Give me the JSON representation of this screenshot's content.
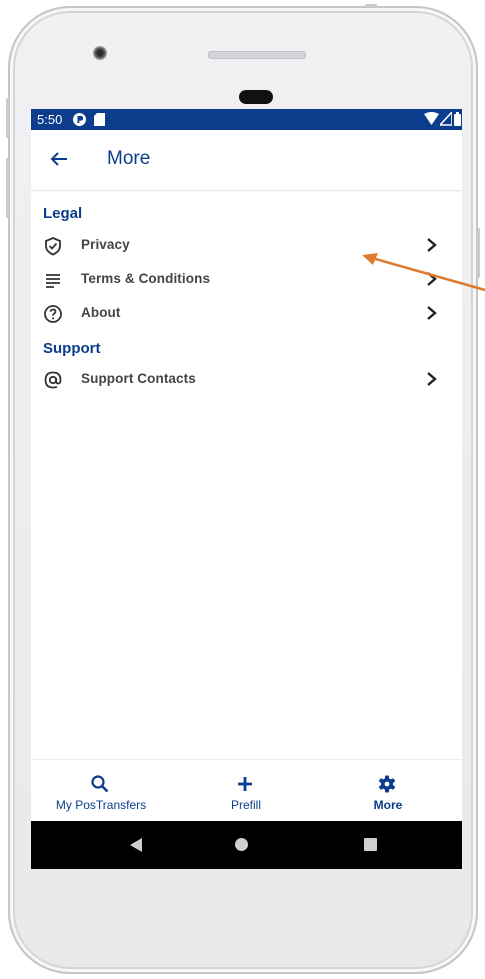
{
  "status_bar": {
    "time": "5:50"
  },
  "app_bar": {
    "title": "More"
  },
  "sections": [
    {
      "title": "Legal"
    },
    {
      "title": "Support"
    }
  ],
  "items": [
    {
      "label": "Privacy",
      "icon": "shield-check-icon"
    },
    {
      "label": "Terms & Conditions",
      "icon": "lines-icon"
    },
    {
      "label": "About",
      "icon": "question-circle-icon"
    },
    {
      "label": "Support Contacts",
      "icon": "at-sign-icon"
    }
  ],
  "bottom_nav": [
    {
      "label": "My PosTransfers",
      "icon": "search-icon"
    },
    {
      "label": "Prefill",
      "icon": "plus-icon"
    },
    {
      "label": "More",
      "icon": "gear-icon",
      "active": true
    }
  ],
  "colors": {
    "primary": "#0b3d8c",
    "annotation_arrow": "#e07a2e"
  }
}
